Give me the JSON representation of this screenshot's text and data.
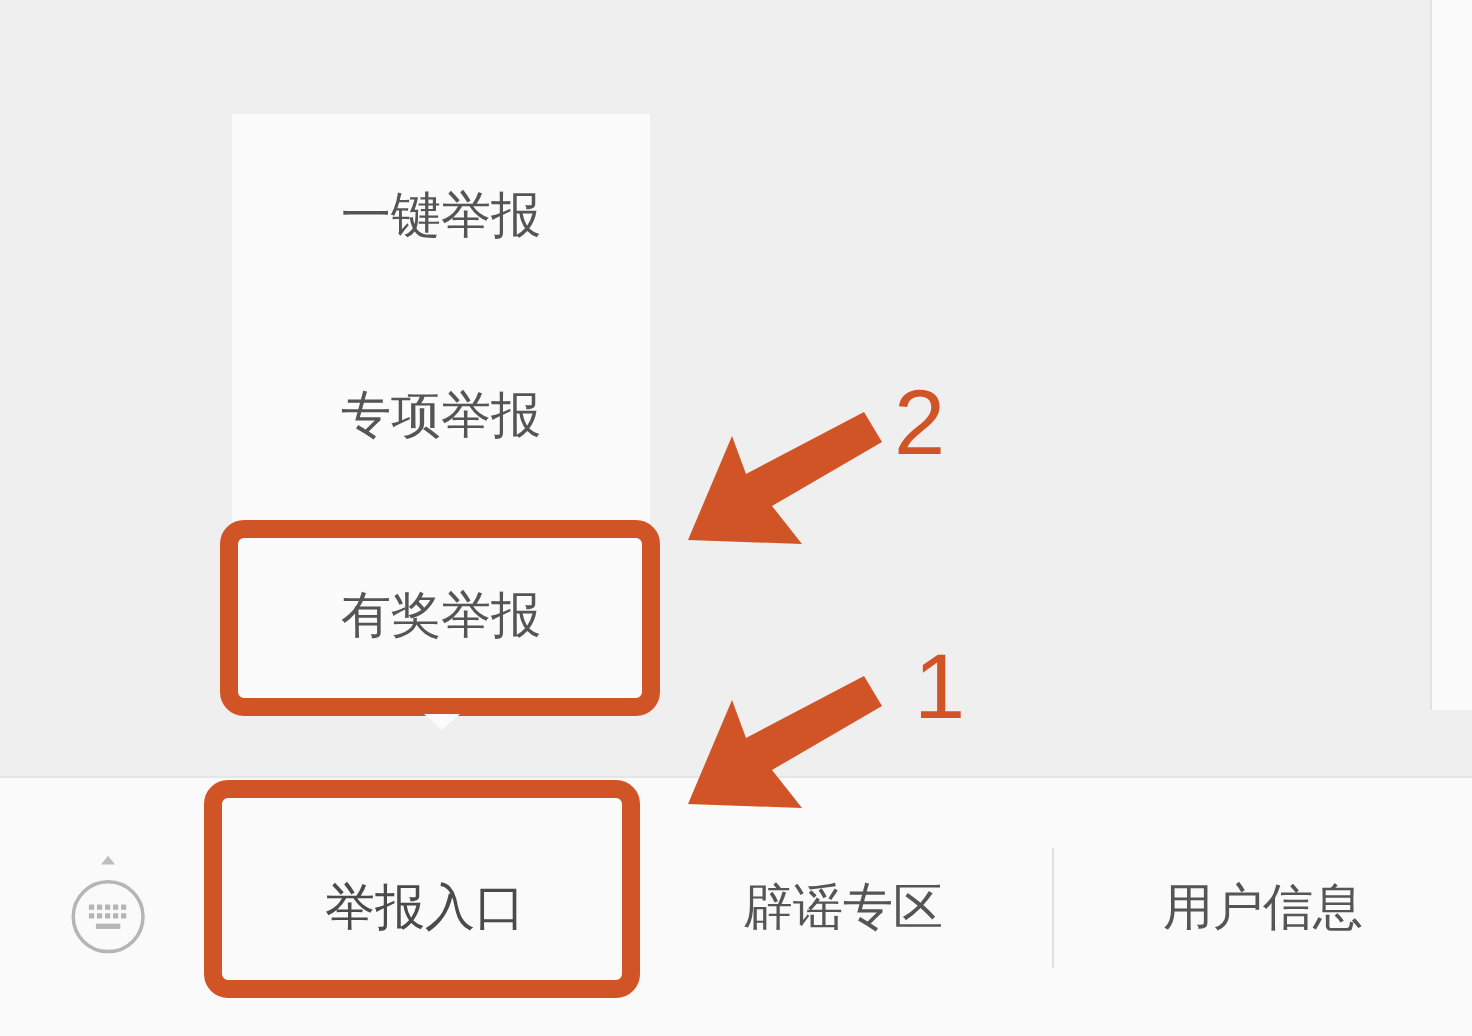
{
  "submenu": {
    "items": [
      {
        "label": "一键举报",
        "highlighted": false
      },
      {
        "label": "专项举报",
        "highlighted": false
      },
      {
        "label": "有奖举报",
        "highlighted": true
      }
    ]
  },
  "menu_bar": {
    "items": [
      {
        "label": "举报入口",
        "highlighted": true,
        "open": true
      },
      {
        "label": "辟谣专区",
        "highlighted": false,
        "open": false
      },
      {
        "label": "用户信息",
        "highlighted": false,
        "open": false
      }
    ]
  },
  "annotations": [
    {
      "label": "2"
    },
    {
      "label": "1"
    }
  ]
}
